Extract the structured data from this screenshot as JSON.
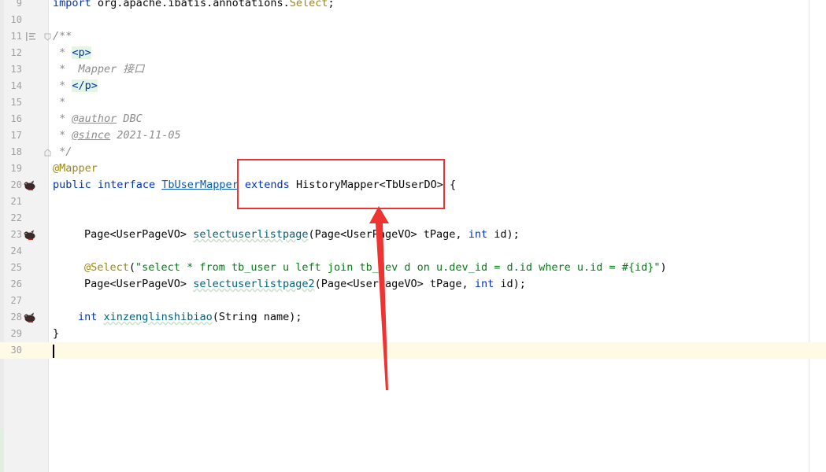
{
  "editor": {
    "colors": {
      "keyword": "#0033b3",
      "annotation": "#9e880d",
      "string": "#067d17",
      "comment": "#8c8c8c",
      "method": "#00627a",
      "annotation_callout": "#ee3333",
      "current_line": "#fffae3"
    },
    "line_numbers": [
      "9",
      "10",
      "11",
      "12",
      "13",
      "14",
      "15",
      "16",
      "17",
      "18",
      "19",
      "20",
      "21",
      "22",
      "23",
      "24",
      "25",
      "26",
      "27",
      "28",
      "29",
      "30"
    ],
    "lines": {
      "l9": {
        "kw": "import",
        "pkg": " org.apache.ibatis.annotations.",
        "ann": "Select",
        "end": ";"
      },
      "l11": {
        "cmt": "/**"
      },
      "l12": {
        "star": " * ",
        "tag": "<p>"
      },
      "l13": {
        "text": " *  Mapper 接口"
      },
      "l14": {
        "star": " * ",
        "tag": "</p>"
      },
      "l15": {
        "text": " *"
      },
      "l16": {
        "star": " * ",
        "tag": "@author",
        "rest": " DBC"
      },
      "l17": {
        "star": " * ",
        "tag": "@since",
        "rest": " 2021-11-05"
      },
      "l18": {
        "text": " */"
      },
      "l19": {
        "ann": "@Mapper"
      },
      "l20": {
        "kw1": "public",
        "kw2": "interface",
        "name": "TbUserMapper",
        "kw3": "extends",
        "parent": "HistoryMapper<TbUserDO>",
        "brace": "{"
      },
      "l23": {
        "ret": "Page<UserPageVO>",
        "method": "selectuserlistpage",
        "params_a": "(Page<UserPageVO> tPage, ",
        "kw": "int",
        "params_b": " id);"
      },
      "l25": {
        "ann": "@Select",
        "open": "(",
        "str": "\"select * from tb_user u left join tb_dev d on u.dev_id = d.id where u.id = #{id}\"",
        "close": ")"
      },
      "l26": {
        "ret": "Page<UserPageVO>",
        "method": "selectuserlistpage2",
        "params_a": "(Page<UserPageVO> tPage, ",
        "kw": "int",
        "params_b": " id);"
      },
      "l28": {
        "kw": "int",
        "method": "xinzenglinshibiao",
        "params": "(String name);"
      },
      "l29": {
        "brace": "}"
      }
    },
    "gutter_icons": [
      "mybatis-icon",
      "mybatis-icon",
      "mybatis-icon"
    ]
  }
}
